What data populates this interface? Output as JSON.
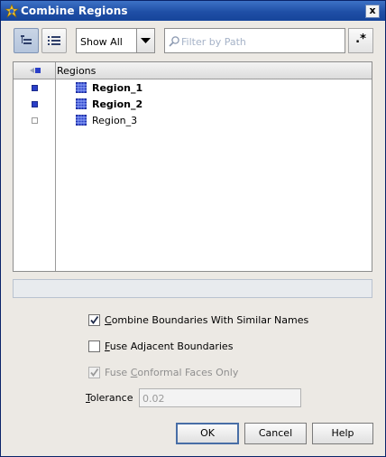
{
  "dialog": {
    "title": "Combine Regions",
    "close_glyph": "x"
  },
  "toolbar": {
    "tree_view_icon": "tree-view-icon",
    "list_view_icon": "list-view-icon",
    "show_filter": {
      "selected": "Show All"
    },
    "filter_placeholder": "Filter by Path",
    "regex_button_label": ".*"
  },
  "table": {
    "column_name": "Regions",
    "rows": [
      {
        "name": "Region_1",
        "selected": true,
        "bold": true
      },
      {
        "name": "Region_2",
        "selected": true,
        "bold": true
      },
      {
        "name": "Region_3",
        "selected": false,
        "bold": false
      }
    ]
  },
  "options": {
    "combine_boundaries": {
      "label_pre": "",
      "label_mnemonic": "C",
      "label_post": "ombine Boundaries With Similar Names",
      "checked": true,
      "enabled": true
    },
    "fuse_adjacent": {
      "label_pre": "",
      "label_mnemonic": "F",
      "label_post": "use Adjacent Boundaries",
      "checked": false,
      "enabled": true
    },
    "fuse_conformal": {
      "label_pre": "Fuse ",
      "label_mnemonic": "C",
      "label_post": "onformal Faces Only",
      "checked": true,
      "enabled": false
    }
  },
  "tolerance": {
    "label_mnemonic": "T",
    "label_post": "olerance",
    "value": "0.02"
  },
  "buttons": {
    "ok": "OK",
    "cancel": "Cancel",
    "help": "Help"
  },
  "colors": {
    "title_bar": "#1f4fa6",
    "selected_marker": "#2a3fc8",
    "region_icon": "#2a3fc8"
  }
}
